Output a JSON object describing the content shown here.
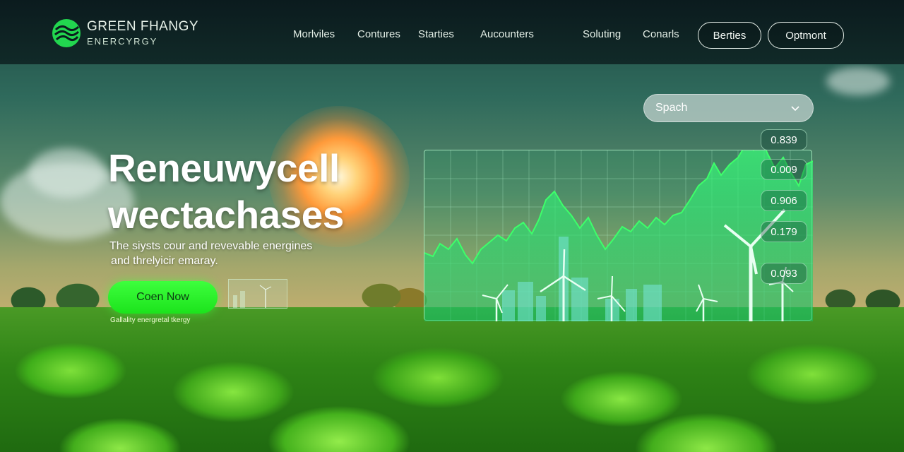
{
  "brand": {
    "name_line1": "GREEN FHANGY",
    "name_line2": "ENERCYRGY",
    "accent_color": "#2ee36a"
  },
  "nav": {
    "links": [
      "Morlviles",
      "Contures",
      "Starties",
      "Aucounters",
      "Soluting",
      "Conarls"
    ],
    "buttons": [
      "Berties",
      "Optmont"
    ]
  },
  "hero": {
    "title_line1": "Reneuwycell",
    "title_line2": "wectachases",
    "subtitle_line1": "The siysts cour and revevable energines",
    "subtitle_line2": "and threlyicir emaray.",
    "cta_label": "Coen Now",
    "cta_caption": "Gallality energretal tkergy",
    "cta_color": "#22ee22"
  },
  "search": {
    "placeholder": "Spach",
    "icon": "chevron-down-icon"
  },
  "chart_panel": {
    "value_labels": [
      "0.839",
      "0.009",
      "0.906",
      "0.179",
      "0.093"
    ],
    "line_color": "#3dff6a",
    "fill_color": "#1fd672"
  }
}
